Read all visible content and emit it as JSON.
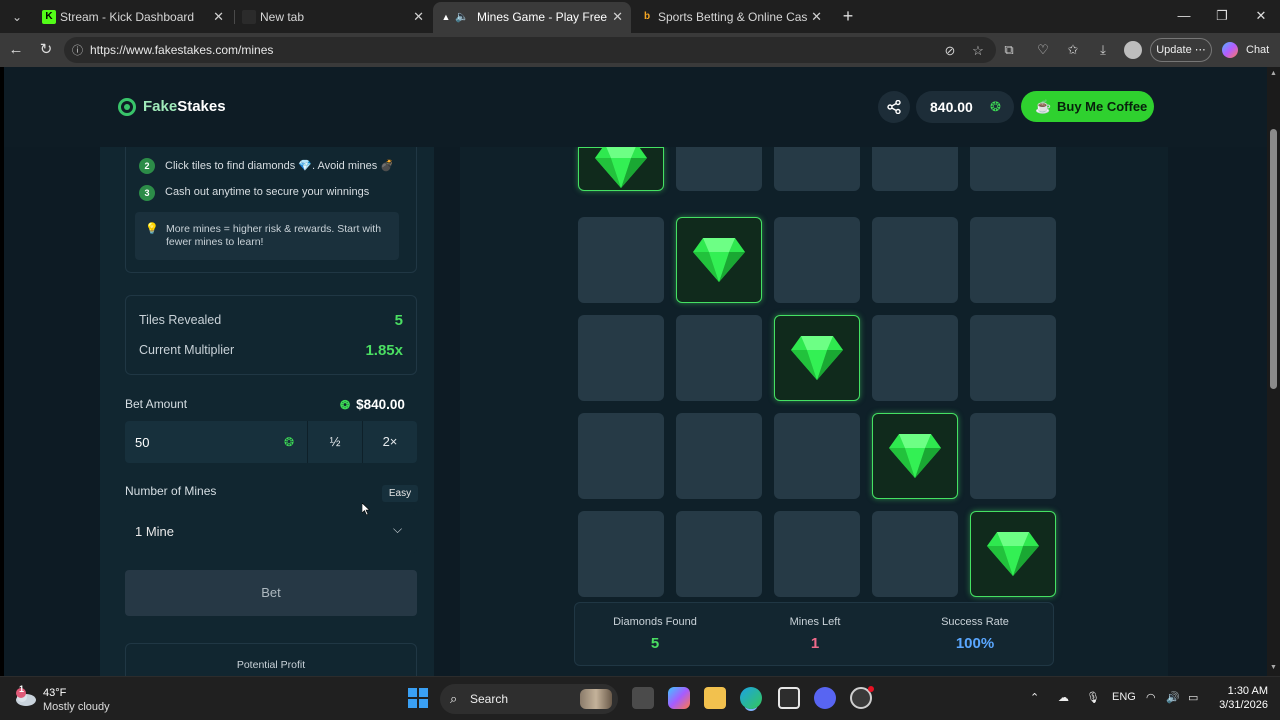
{
  "tabs": [
    {
      "title": "Stream - Kick Dashboard",
      "active": false
    },
    {
      "title": "New tab",
      "active": false
    },
    {
      "title": "Mines Game - Play Free Onlin",
      "active": true
    },
    {
      "title": "Sports Betting & Online Casino at",
      "active": false
    }
  ],
  "address_bar": {
    "url": "https://www.fakestakes.com/mines"
  },
  "toolbar": {
    "update_label": "Update",
    "chat_label": "Chat"
  },
  "site": {
    "logo_part1": "Fake",
    "logo_part2": "Stakes",
    "balance": "840.00",
    "coffee_label": "Buy Me Coffee"
  },
  "instructions": {
    "step2_num": "2",
    "step2": "Click tiles to find diamonds 💎. Avoid mines 💣",
    "step3_num": "3",
    "step3": "Cash out anytime to secure your winnings",
    "tip": "More mines = higher risk & rewards. Start with fewer mines to learn!"
  },
  "round_stats": {
    "tiles_revealed_label": "Tiles Revealed",
    "tiles_revealed": "5",
    "multiplier_label": "Current Multiplier",
    "multiplier": "1.85x"
  },
  "bet": {
    "label": "Bet Amount",
    "balance": "$840.00",
    "amount": "50",
    "half_label": "½",
    "double_label": "2×"
  },
  "mines": {
    "label": "Number of Mines",
    "difficulty": "Easy",
    "selected": "1 Mine"
  },
  "bet_button": "Bet",
  "potential_profit_label": "Potential Profit",
  "board": {
    "rows": [
      [
        "diamond",
        "hidden",
        "hidden",
        "hidden",
        "hidden"
      ],
      [
        "hidden",
        "diamond",
        "hidden",
        "hidden",
        "hidden"
      ],
      [
        "hidden",
        "hidden",
        "diamond",
        "hidden",
        "hidden"
      ],
      [
        "hidden",
        "hidden",
        "hidden",
        "diamond",
        "hidden"
      ],
      [
        "hidden",
        "hidden",
        "hidden",
        "hidden",
        "diamond"
      ]
    ]
  },
  "game_stats": {
    "diamonds_label": "Diamonds Found",
    "diamonds": "5",
    "mines_label": "Mines Left",
    "mines_left": "1",
    "success_label": "Success Rate",
    "success": "100%"
  },
  "colors": {
    "accent": "#3ddc55",
    "mines_left": "#f06a8a",
    "success": "#5aa7ff"
  },
  "taskbar": {
    "temp": "43°F",
    "condition": "Mostly cloudy",
    "weather_badge": "1",
    "search_label": "Search",
    "language": "ENG",
    "time": "1:30 AM",
    "date": "3/31/2026"
  }
}
